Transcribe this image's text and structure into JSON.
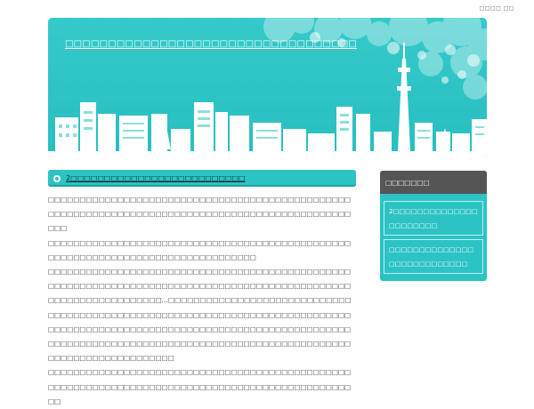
{
  "topbar": {
    "text": "□□□□ □□"
  },
  "header": {
    "title": "□□□□□□□□□□□□□□□□□□□□□□□□□□□□□□□□□□",
    "colors": {
      "background": "#2cc3c4",
      "building": "#ffffff"
    }
  },
  "post": {
    "title": "2□□□□□□□□□□□□□□□□□□□□□□□□□□",
    "paragraphs": [
      "□□□□□□□□□□□□□□□□□□□□□□□□□□□□□□□□□□□□□□□□□□□□□□□□□□□□□□□□□□□□□□□□□□□□□□□□□□□□□□□□□□□□□□□□□□□□□□□□□□□",
      "□□□□□□□□□□□□□□□□□□□□□□□□□□□□□□□□□□□□□□□□□□□□□□□□□□□□□□□□□□□□□□□□□□□□□□□□□□□□□□□□□",
      "□□□□□□□□□□□□□□□□□□□□□□□□□□□□□□□□□□□□□□□□□□□□□□□□□□□□□□□□□□□□□□□□□□□□□□□□□□□□□□□□□□□□□□□□□□□□□□□□",
      "□□□□□□□□□□□□□□□□□□…□□□□□□□□□□□□□□□□□□□□□□□□□□□□□□□□□□□□□□□□□□□□□□□□□□□□□□□□□□□□□□□□□□□□□□□□□□□□□",
      "□□□□□□□□□□□□□□□□□□□□□□□□□□□□□□□□□□□□□□□□□□□□□□□□□□□□□□□□□□□□□□□□□□□□□□□□□□□□□□□□□□□□□□□□□□□□□□□□□□□□□□□□□□□□□□□□□□□□",
      "□□□□□□□□□□□□□□□□□□□□□□□□□□□□□□□□□□□□□□□□□□□□□□□□□□□□□□□□□□□□□□□□□□□□□□□□□□□□□□□□□□□□□□□□□□□□□□□□□□"
    ]
  },
  "sidebar": {
    "heading": "□□□□□□□",
    "links": [
      "2□□□□□□□□□□□□□□□□□□□□□□",
      "□□□□□□□□□□□□□□□□□□□□□□□□□□□"
    ]
  }
}
